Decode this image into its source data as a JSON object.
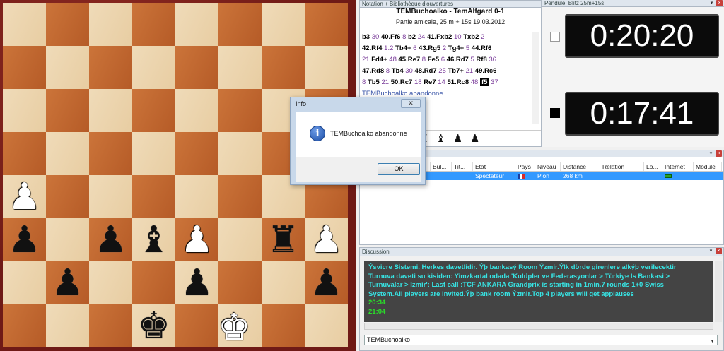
{
  "notation": {
    "header": "Notation + Bibliothèque d'ouvertures",
    "title": "TEMBuchoalko - TemAlfgard  0-1",
    "subtitle": "Partie amicale, 25 m + 15s 19.03.2012",
    "moves": [
      [
        [
          "m",
          "b3"
        ],
        [
          "t",
          "30"
        ],
        [
          "m",
          "40.Ff6"
        ],
        [
          "t",
          "8"
        ],
        [
          "m",
          "b2"
        ],
        [
          "t",
          "24"
        ],
        [
          "m",
          "41.Fxb2"
        ],
        [
          "t",
          "10"
        ],
        [
          "m",
          "Txb2"
        ],
        [
          "t",
          "2"
        ]
      ],
      [
        [
          "m",
          "42.Rf4"
        ],
        [
          "t",
          "1.2"
        ],
        [
          "m",
          "Tb4+"
        ],
        [
          "t",
          "6"
        ],
        [
          "m",
          "43.Rg5"
        ],
        [
          "t",
          "2"
        ],
        [
          "m",
          "Tg4+"
        ],
        [
          "t",
          "5"
        ],
        [
          "m",
          "44.Rf6"
        ]
      ],
      [
        [
          "t",
          "21"
        ],
        [
          "m",
          "Fd4+"
        ],
        [
          "t",
          "48"
        ],
        [
          "m",
          "45.Re7"
        ],
        [
          "t",
          "8"
        ],
        [
          "m",
          "Fe5"
        ],
        [
          "t",
          "6"
        ],
        [
          "m",
          "46.Rd7"
        ],
        [
          "t",
          "5"
        ],
        [
          "m",
          "Rf8"
        ],
        [
          "t",
          "36"
        ]
      ],
      [
        [
          "m",
          "47.Rd8"
        ],
        [
          "t",
          "8"
        ],
        [
          "m",
          "Tb4"
        ],
        [
          "t",
          "30"
        ],
        [
          "m",
          "48.Rd7"
        ],
        [
          "t",
          "25"
        ],
        [
          "m",
          "Tb7+"
        ],
        [
          "t",
          "21"
        ],
        [
          "m",
          "49.Rc6"
        ]
      ],
      [
        [
          "t",
          "8"
        ],
        [
          "m",
          "Tb5"
        ],
        [
          "t",
          "21"
        ],
        [
          "m",
          "50.Rc7"
        ],
        [
          "t",
          "18"
        ],
        [
          "m",
          "Re7"
        ],
        [
          "t",
          "14"
        ],
        [
          "m",
          "51.Rc8"
        ],
        [
          "t",
          "48"
        ],
        [
          "cur",
          "f5"
        ],
        [
          "t",
          "37"
        ]
      ],
      [
        [
          "res",
          "TEMBuchoalko abandonne"
        ]
      ]
    ],
    "captured": "♜ ♝ ♟ ♟"
  },
  "clocks": {
    "header": "Pendule: Blitz 25m+15s",
    "top_time": "0:20:20",
    "bottom_time": "0:17:41"
  },
  "players": {
    "columns": [
      "",
      "Bul...",
      "Tit...",
      "Etat",
      "Pays",
      "Niveau",
      "Distance",
      "Relation",
      "Lo...",
      "Internet",
      "Module"
    ],
    "row": {
      "etat": "Spectateur",
      "niveau": "Pion",
      "distance": "268 km"
    }
  },
  "discussion": {
    "header": "Discussion",
    "lines": [
      "Ýsvicre Sistemi. Herkes davetlidir. Ýþ bankasý Room Ýzmir.Ýlk dörde girenlere alkýþ verilecektir",
      "Turnuva daveti su kisiden: Yimzkartal odada 'Kulüpler ve Federasyonlar > Türkiye Is Bankasi >",
      "Turnuvalar > Izmir': Last call :TCF ANKARA Grandprix is starting in 1min.7 rounds 1+0 Swiss",
      "System.All players are invited.Ýþ bank room Ýzmir.Top 4 players will get applauses"
    ],
    "times": [
      "20:34",
      "21:04"
    ],
    "input_value": "TEMBuchoalko"
  },
  "dialog": {
    "title": "Info",
    "message": "TEMBuchoalko abandonne",
    "ok": "OK"
  },
  "colors": {
    "accent": "#3399ff",
    "chat_text": "#37e3e3",
    "chat_time": "#29e029"
  }
}
